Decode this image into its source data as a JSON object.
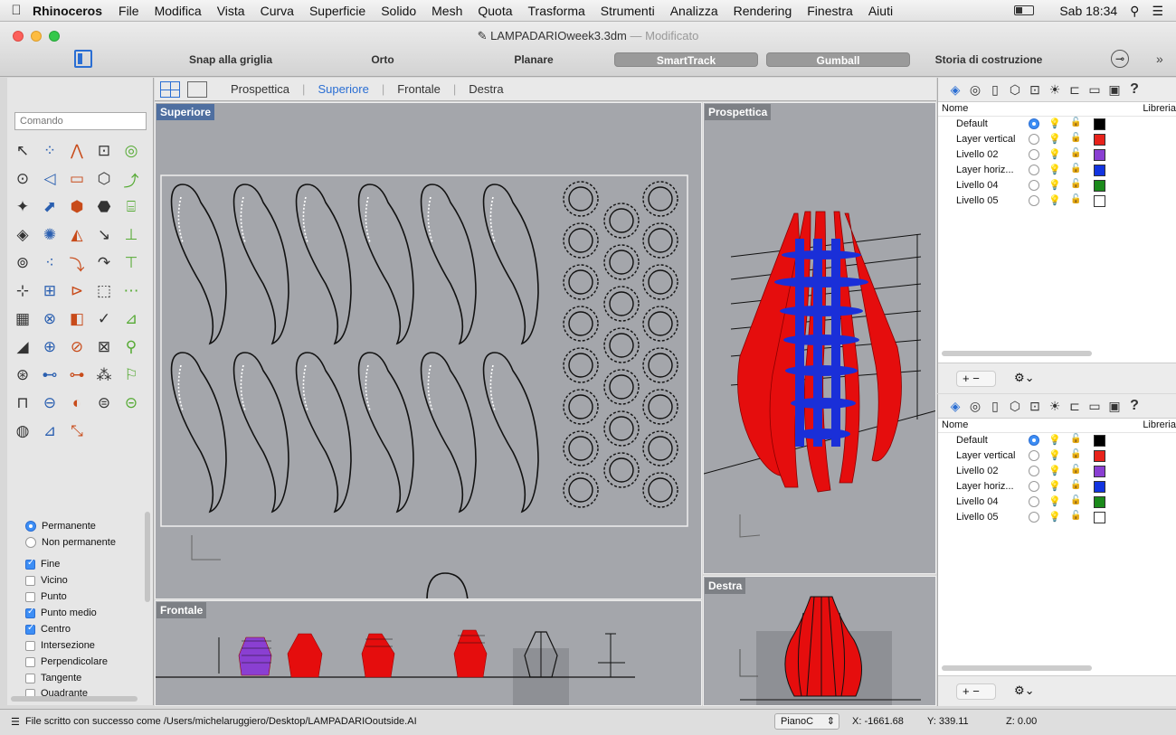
{
  "menubar": {
    "app": "Rhinoceros",
    "items": [
      "File",
      "Modifica",
      "Vista",
      "Curva",
      "Superficie",
      "Solido",
      "Mesh",
      "Quota",
      "Trasforma",
      "Strumenti",
      "Analizza",
      "Rendering",
      "Finestra",
      "Aiuti"
    ],
    "clock": "Sab 18:34"
  },
  "window": {
    "title": "LAMPADARIOweek3.3dm",
    "modified": "— Modificato"
  },
  "toolbar": {
    "snap_grid": "Snap alla griglia",
    "orto": "Orto",
    "planare": "Planare",
    "smarttrack": "SmartTrack",
    "gumball": "Gumball",
    "history": "Storia di costruzione"
  },
  "command": {
    "placeholder": "Comando"
  },
  "tools": [
    "↖",
    "⁘",
    "⋀",
    "⊡",
    "◎",
    "⊙",
    "◁",
    "▭",
    "⬡",
    "⤴",
    "✦",
    "⬈",
    "⬢",
    "⬣",
    "⌸",
    "◈",
    "✺",
    "◭",
    "↘",
    "⊥",
    "⊚",
    "⁖",
    "⤵",
    "↷",
    "⊤",
    "⊹",
    "⊞",
    "⊳",
    "⬚",
    "⋯",
    "▦",
    "⊗",
    "◧",
    "✓",
    "⊿",
    "◢",
    "⊕",
    "⊘",
    "⊠",
    "⚲",
    "⊛",
    "⊷",
    "⊶",
    "⁂",
    "⚐",
    "⊓",
    "⊖",
    "◐",
    "⊜",
    "⊝",
    "◍",
    "⊿",
    "⤡"
  ],
  "osnap": {
    "modes": [
      {
        "label": "Permanente",
        "on": true
      },
      {
        "label": "Non permanente",
        "on": false
      }
    ],
    "items": [
      {
        "label": "Fine",
        "on": true
      },
      {
        "label": "Vicino",
        "on": false
      },
      {
        "label": "Punto",
        "on": false
      },
      {
        "label": "Punto medio",
        "on": true
      },
      {
        "label": "Centro",
        "on": true
      },
      {
        "label": "Intersezione",
        "on": false
      },
      {
        "label": "Perpendicolare",
        "on": false
      },
      {
        "label": "Tangente",
        "on": false
      },
      {
        "label": "Quadrante",
        "on": false
      }
    ]
  },
  "viewport_tabs": [
    "Prospettica",
    "Superiore",
    "Frontale",
    "Destra"
  ],
  "viewports": {
    "top": "Superiore",
    "perspective": "Prospettica",
    "front": "Frontale",
    "right": "Destra"
  },
  "layers_panel": {
    "col_name": "Nome",
    "col_lib": "Libreria",
    "layers": [
      {
        "name": "Default",
        "color": "#000000",
        "current": true
      },
      {
        "name": "Layer vertical",
        "color": "#e8231b",
        "current": false
      },
      {
        "name": "Livello 02",
        "color": "#8a3fd2",
        "current": false
      },
      {
        "name": "Layer horiz...",
        "color": "#1234e0",
        "current": false
      },
      {
        "name": "Livello 04",
        "color": "#1b8a1b",
        "current": false
      },
      {
        "name": "Livello 05",
        "color": "#ffffff",
        "current": false
      }
    ]
  },
  "status": {
    "message": "File scritto con successo come /Users/michelaruggiero/Desktop/LAMPADARIOoutside.AI",
    "cplane": "PianoC",
    "x": "X: -1661.68",
    "y": "Y: 339.11",
    "z": "Z: 0.00"
  },
  "colors": {
    "accent": "#2a6ed3",
    "lamp_red": "#e50d0d",
    "lamp_blue": "#1a2fd8"
  }
}
